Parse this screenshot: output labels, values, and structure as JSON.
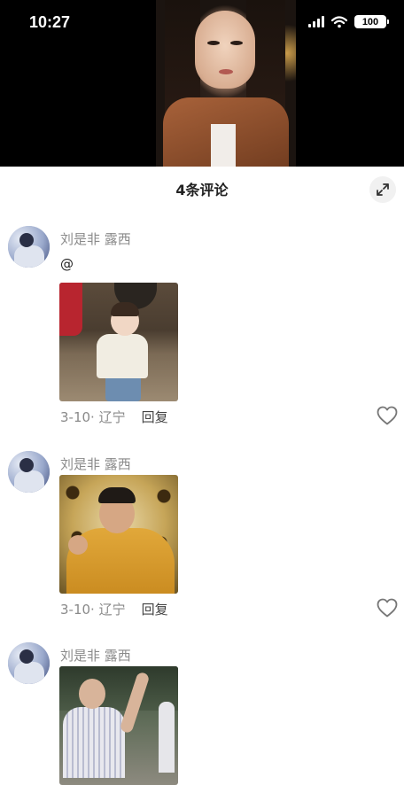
{
  "status_bar": {
    "time": "10:27",
    "battery": "100"
  },
  "sheet": {
    "title": "4条评论"
  },
  "comments": [
    {
      "user": "刘是非 露西",
      "text": "@",
      "date_loc": "3-10· 辽宁",
      "reply": "回复"
    },
    {
      "user": "刘是非 露西",
      "text": "",
      "date_loc": "3-10· 辽宁",
      "reply": "回复"
    },
    {
      "user": "刘是非 露西",
      "text": "",
      "date_loc": "",
      "reply": ""
    }
  ],
  "icons": {
    "expand": "expand-icon",
    "like": "heart-outline-icon",
    "signal": "cellular-signal-icon",
    "wifi": "wifi-icon"
  }
}
